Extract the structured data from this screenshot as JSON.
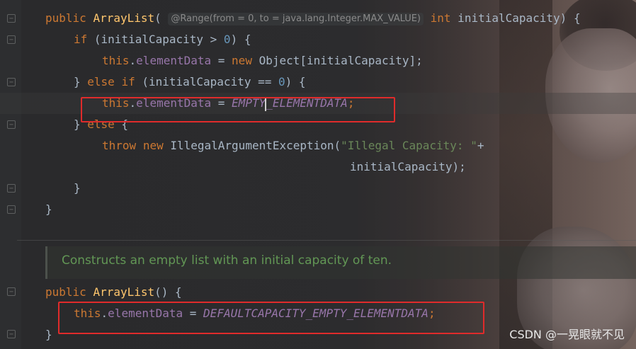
{
  "editor": {
    "line1": {
      "kw": "public",
      "fn": "ArrayList",
      "open": "(",
      "hint": "@Range(from = 0, to = java.lang.Integer.MAX_VALUE)",
      "type": "int",
      "rest": " initialCapacity) {"
    },
    "line2": {
      "kw": "if",
      "a": " (initialCapacity > ",
      "num": "0",
      "b": ") {"
    },
    "line3": {
      "this": "this",
      "dot": ".",
      "field": "elementData",
      "eq": " = ",
      "new": "new",
      "rest": " Object[initialCapacity];"
    },
    "line4": {
      "a": "} ",
      "else": "else",
      "sp": " ",
      "if": "if",
      "b": " (initialCapacity == ",
      "num": "0",
      "c": ") {"
    },
    "line5": {
      "this": "this",
      "dot": ".",
      "field": "elementData",
      "eq": " = ",
      "const": "EMPTY_ELEMENTDATA",
      "semi": ";"
    },
    "line6": {
      "a": "} ",
      "else": "else",
      "b": " {"
    },
    "line7": {
      "throw": "throw",
      "sp": " ",
      "new": "new",
      "a": " IllegalArgumentException(",
      "str": "\"Illegal Capacity: \"",
      "plus": "+"
    },
    "line8": {
      "text": "initialCapacity);"
    },
    "line9": {
      "text": "}"
    },
    "line10": {
      "text": "}"
    },
    "doc": "Constructs an empty list with an initial capacity of ten.",
    "line11": {
      "kw": "public",
      "fn": "ArrayList",
      "rest": "() {"
    },
    "line12": {
      "this": "this",
      "dot": ".",
      "field": "elementData",
      "eq": " = ",
      "const": "DEFAULTCAPACITY_EMPTY_ELEMENTDATA",
      "semi": ";"
    },
    "line13": {
      "text": "}"
    }
  },
  "watermark": "CSDN @一晃眼就不见",
  "colors": {
    "keyword": "#cc7832",
    "method": "#ffc66d",
    "field": "#9876aa",
    "number": "#6897bb",
    "string": "#6a8759",
    "doc": "#629755",
    "highlight_box": "#e02b2b"
  }
}
